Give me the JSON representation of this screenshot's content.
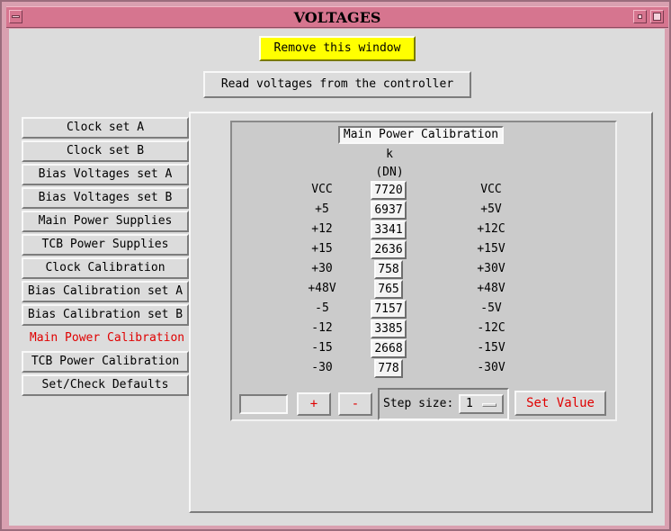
{
  "window": {
    "title": "VOLTAGES"
  },
  "top": {
    "remove_label": "Remove this window",
    "read_label": "Read voltages from the controller"
  },
  "sidebar": {
    "items": [
      {
        "label": "Clock set A"
      },
      {
        "label": "Clock set B"
      },
      {
        "label": "Bias Voltages set A"
      },
      {
        "label": "Bias Voltages set B"
      },
      {
        "label": "Main Power Supplies"
      },
      {
        "label": "TCB Power Supplies"
      },
      {
        "label": "Clock Calibration"
      },
      {
        "label": "Bias Calibration set A"
      },
      {
        "label": "Bias Calibration set B"
      },
      {
        "label": "Main Power Calibration",
        "active": true
      },
      {
        "label": "TCB Power Calibration"
      },
      {
        "label": "Set/Check Defaults"
      }
    ],
    "active_color": "#e00000"
  },
  "panel": {
    "title": "Main Power Calibration",
    "col_k": "k",
    "col_unit": "(DN)",
    "rows": [
      {
        "left": "VCC",
        "value": "7720",
        "right": "VCC"
      },
      {
        "left": "+5",
        "value": "6937",
        "right": "+5V"
      },
      {
        "left": "+12",
        "value": "3341",
        "right": "+12C"
      },
      {
        "left": "+15",
        "value": "2636",
        "right": "+15V"
      },
      {
        "left": "+30",
        "value": "758",
        "right": "+30V"
      },
      {
        "left": "+48V",
        "value": "765",
        "right": "+48V"
      },
      {
        "left": "-5",
        "value": "7157",
        "right": "-5V"
      },
      {
        "left": "-12",
        "value": "3385",
        "right": "-12C"
      },
      {
        "left": "-15",
        "value": "2668",
        "right": "-15V"
      },
      {
        "left": "-30",
        "value": "778",
        "right": "-30V"
      }
    ],
    "controls": {
      "entry_value": "",
      "plus_label": "+",
      "minus_label": "-",
      "step_label": "Step size:",
      "step_value": "1",
      "set_value_label": "Set Value"
    }
  },
  "colors": {
    "title_bar": "#d6758f",
    "remove_button": "#ffff00",
    "accent_red": "#e00000"
  }
}
